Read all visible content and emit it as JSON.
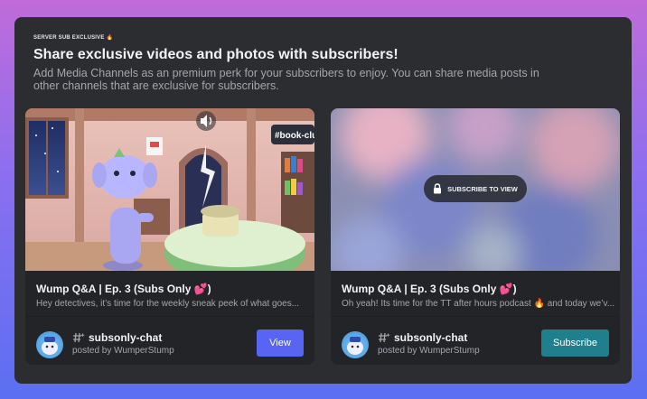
{
  "eyebrow": "SERVER SUB EXCLUSIVE 🔥",
  "headline": "Share exclusive videos and photos with subscribers!",
  "subtitle": "Add Media Channels as an premium perk for your subscribers to enjoy. You can share media posts in other channels that are exclusive for subscribers.",
  "scene_label": "#book-club",
  "cards": [
    {
      "title": "Wump Q&A | Ep. 3 (Subs Only 💕)",
      "description": "Hey detectives, it’s time for the weekly sneak peek of what goes...",
      "channel": "subsonly-chat",
      "posted_by": "posted by WumperStump",
      "button": "View"
    },
    {
      "title": "Wump Q&A | Ep. 3 (Subs Only 💕)",
      "description": "Oh yeah! Its time for the TT after hours podcast 🔥 and today we’v...",
      "channel": "subsonly-chat",
      "posted_by": "posted by WumperStump",
      "button": "Subscribe",
      "overlay_label": "SUBSCRIBE TO VIEW"
    }
  ],
  "icons": {
    "volume": "speaker-icon",
    "lock": "lock-icon",
    "channel": "hash-sparkle-icon"
  },
  "colors": {
    "view_button": "#5865f2",
    "subscribe_button": "#1f7f8c",
    "panel": "#2b2d31"
  }
}
